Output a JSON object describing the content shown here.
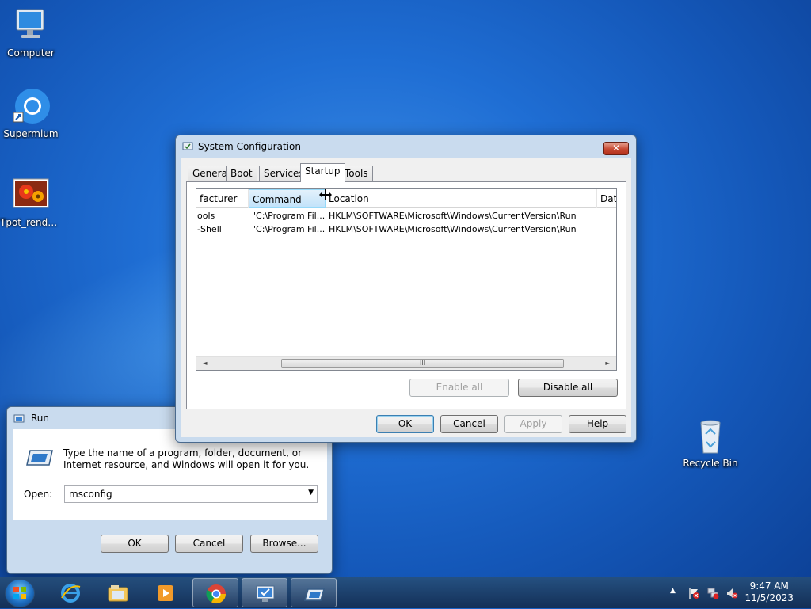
{
  "desktop": {
    "icons": [
      {
        "label": "Computer"
      },
      {
        "label": "Supermium"
      },
      {
        "label": "Tpot_rende..."
      },
      {
        "label": "Recycle Bin"
      }
    ]
  },
  "sysconfig": {
    "title": "System Configuration",
    "tabs": [
      "General",
      "Boot",
      "Services",
      "Startup",
      "Tools"
    ],
    "active_tab": "Startup",
    "columns": [
      "facturer",
      "Command",
      "Location",
      "Date"
    ],
    "rows": [
      {
        "manufacturer": "ools",
        "command": "\"C:\\Program Fil...",
        "location": "HKLM\\SOFTWARE\\Microsoft\\Windows\\CurrentVersion\\Run"
      },
      {
        "manufacturer": "-Shell",
        "command": "\"C:\\Program Fil...",
        "location": "HKLM\\SOFTWARE\\Microsoft\\Windows\\CurrentVersion\\Run"
      }
    ],
    "scroll_grip": "III",
    "enable_all": "Enable all",
    "disable_all": "Disable all",
    "ok": "OK",
    "cancel": "Cancel",
    "apply": "Apply",
    "help": "Help"
  },
  "run": {
    "title": "Run",
    "description": "Type the name of a program, folder, document, or Internet resource, and Windows will open it for you.",
    "open_label": "Open:",
    "open_value": "msconfig",
    "ok": "OK",
    "cancel": "Cancel",
    "browse": "Browse..."
  },
  "taskbar": {
    "pinned": [
      "internet-explorer",
      "file-explorer",
      "media-player",
      "chrome",
      "system-configuration",
      "run"
    ],
    "clock_time": "9:47 AM",
    "clock_date": "11/5/2023"
  },
  "colors": {
    "desktop": "#1f6ed4",
    "window_frame": "#c9dbee",
    "close_red": "#c74a33",
    "column_hot": "#c1e2fa"
  }
}
